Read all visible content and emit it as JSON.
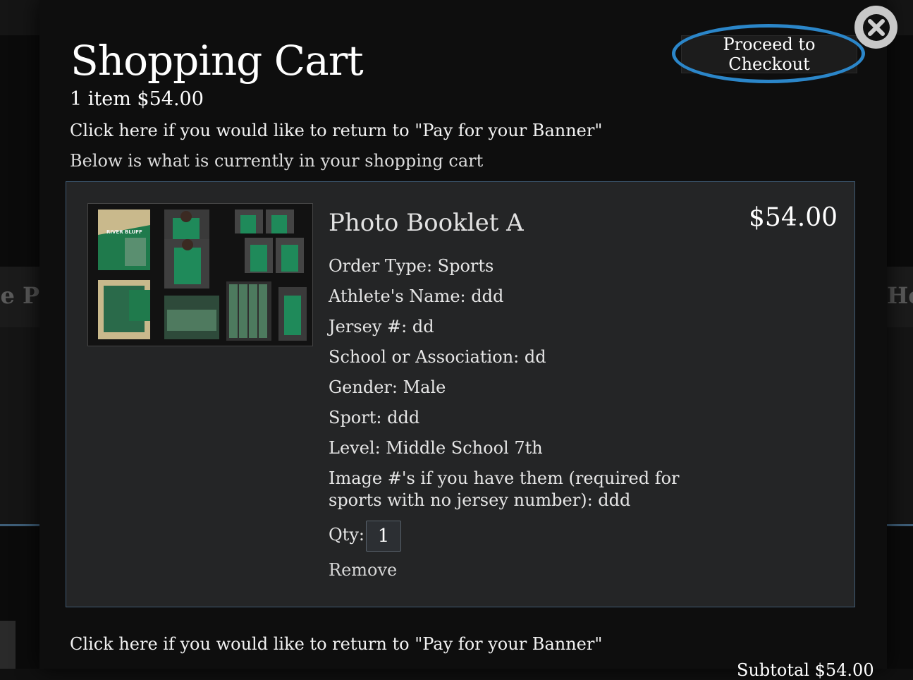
{
  "background": {
    "left_banner_text": "le P",
    "right_banner_text": "He"
  },
  "cart": {
    "title": "Shopping Cart",
    "summary": "1 item $54.00",
    "return_link": "Click here if you would like to return to \"Pay for your Banner\"",
    "subtitle": "Below is what is currently in your shopping cart",
    "checkout_label": "Proceed to Checkout",
    "close_icon": "close-icon",
    "subtotal_peek": "Subtotal $54.00"
  },
  "item": {
    "name": "Photo Booklet A",
    "price": "$54.00",
    "thumbnail_label": "RIVER BLUFF",
    "attributes": [
      "Order Type: Sports",
      "Athlete's Name: ddd",
      "Jersey #: dd",
      "School or Association: dd",
      "Gender: Male",
      "Sport: ddd",
      "Level: Middle School 7th"
    ],
    "image_numbers": "Image #'s if you have them (required for sports with no jersey number): ddd",
    "qty_label": "Qty:",
    "qty_value": "1",
    "remove_label": "Remove"
  },
  "colors": {
    "highlight_ring": "#2b86c9",
    "card_border": "#3f5a73",
    "team_green": "#1f7a4c"
  }
}
